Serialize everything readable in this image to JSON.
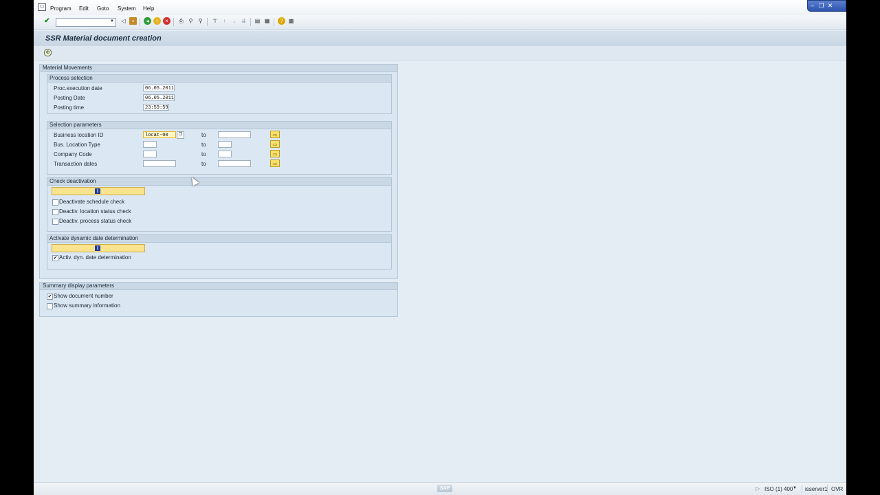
{
  "menu": {
    "items": [
      "Program",
      "Edit",
      "Goto",
      "System",
      "Help"
    ]
  },
  "toolbar": {
    "command_value": ""
  },
  "page": {
    "title": "SSR Material document creation"
  },
  "material_movements": {
    "title": "Material Movements",
    "process_selection": {
      "title": "Process selection",
      "fields": [
        {
          "label": "Proc.execution date",
          "value": "06.05.2011"
        },
        {
          "label": "Posting Date",
          "value": "06.05.2011"
        },
        {
          "label": "Posting time",
          "value": "23:59:59"
        }
      ]
    },
    "selection_parameters": {
      "title": "Selection parameters",
      "to_label": "to",
      "rows": [
        {
          "label": "Business location ID",
          "from": "locat-00",
          "to": ""
        },
        {
          "label": "Bus. Location Type",
          "from": "",
          "to": ""
        },
        {
          "label": "Company Code",
          "from": "",
          "to": ""
        },
        {
          "label": "Transaction dates",
          "from": "",
          "to": ""
        }
      ]
    },
    "check_deactivation": {
      "title": "Check deactivation",
      "checkboxes": [
        {
          "label": "Deactivate schedule check",
          "checked": false
        },
        {
          "label": "Deactiv. location status check",
          "checked": false
        },
        {
          "label": "Deactiv. process status check",
          "checked": false
        }
      ]
    },
    "dynamic_date": {
      "title": "Activate dynamic date determination",
      "checkboxes": [
        {
          "label": "Activ. dyn. date determination",
          "checked": true
        }
      ]
    }
  },
  "summary": {
    "title": "Summary display parameters",
    "checkboxes": [
      {
        "label": "Show document number",
        "checked": true
      },
      {
        "label": "Show summary information",
        "checked": false
      }
    ]
  },
  "status": {
    "logo": "SAP",
    "system": "ISO (1) 400",
    "server": "isserver1",
    "mode": "OVR"
  },
  "icons": {
    "check_mark": "✔",
    "info": "i",
    "multiple_selection": "⇨"
  }
}
